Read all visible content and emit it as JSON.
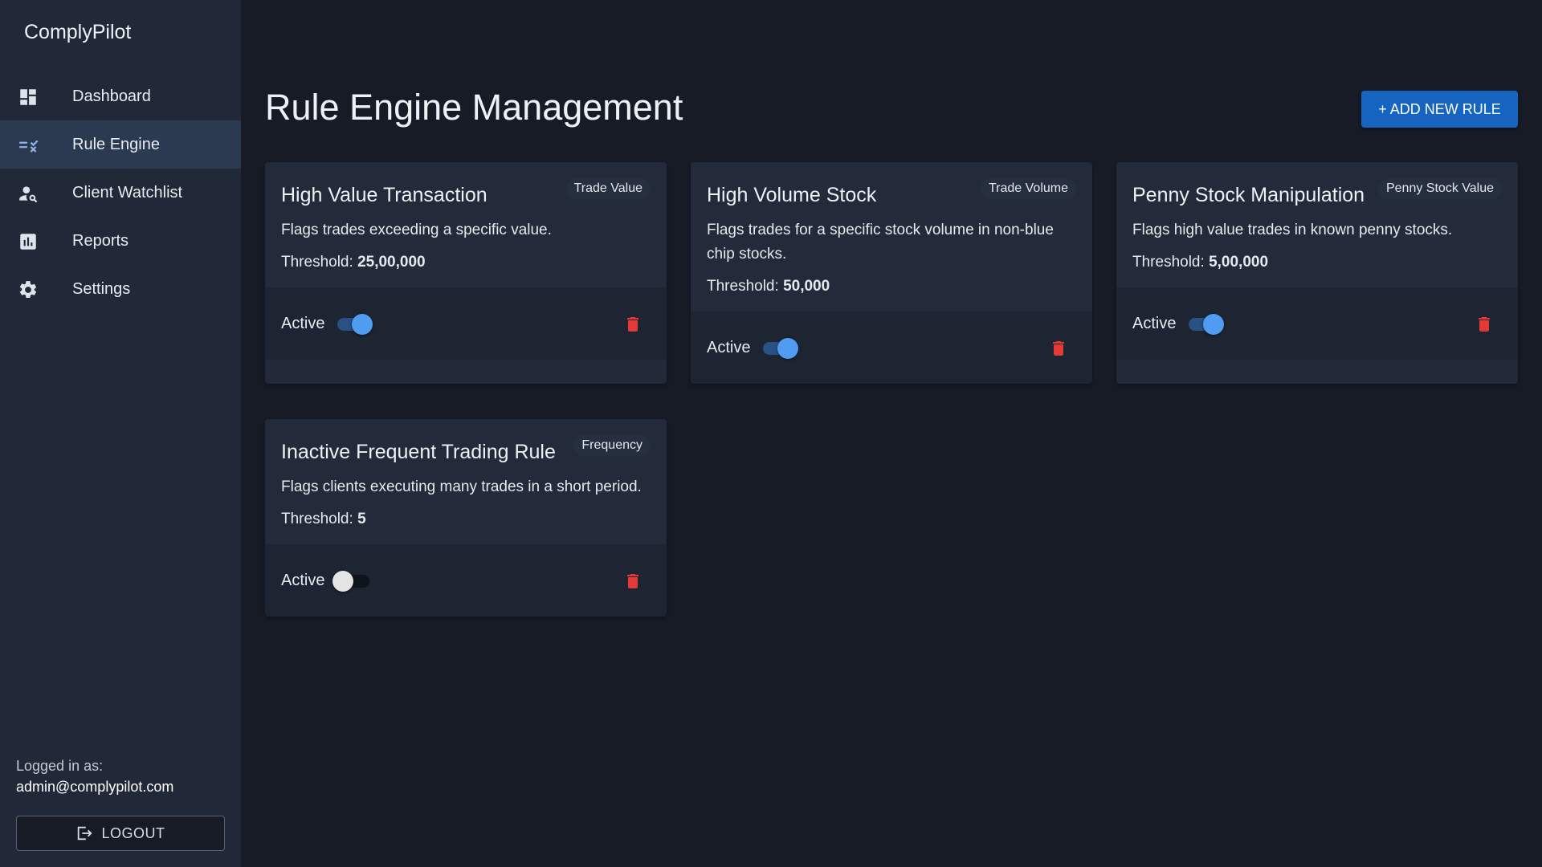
{
  "app": {
    "brand": "ComplyPilot"
  },
  "sidebar": {
    "items": [
      {
        "label": "Dashboard",
        "icon": "dashboard-icon"
      },
      {
        "label": "Rule Engine",
        "icon": "rule-icon",
        "active": true
      },
      {
        "label": "Client Watchlist",
        "icon": "person-search-icon"
      },
      {
        "label": "Reports",
        "icon": "bar-chart-icon"
      },
      {
        "label": "Settings",
        "icon": "gear-icon"
      }
    ],
    "login_caption": "Logged in as:",
    "login_user": "admin@complypilot.com",
    "logout_label": "LOGOUT"
  },
  "main": {
    "title": "Rule Engine Management",
    "add_button_label": "+ ADD NEW RULE",
    "threshold_label": "Threshold:",
    "active_label": "Active",
    "cards": [
      {
        "title": "High Value Transaction",
        "tag": "Trade Value",
        "description": "Flags trades exceeding a specific value.",
        "threshold": "25,00,000",
        "active": true
      },
      {
        "title": "High Volume Stock",
        "tag": "Trade Volume",
        "description": "Flags trades for a specific stock volume in non-blue chip stocks.",
        "threshold": "50,000",
        "active": true
      },
      {
        "title": "Penny Stock Manipulation",
        "tag": "Penny Stock Value",
        "description": "Flags high value trades in known penny stocks.",
        "threshold": "5,00,000",
        "active": true
      },
      {
        "title": "Inactive Frequent Trading Rule",
        "tag": "Frequency",
        "description": "Flags clients executing many trades in a short period.",
        "threshold": "5",
        "active": false
      }
    ]
  },
  "colors": {
    "background": "#161b26",
    "sidebar": "#212939",
    "accent": "#1565c0",
    "toggle_on": "#4f9cf0",
    "delete": "#e53935"
  }
}
